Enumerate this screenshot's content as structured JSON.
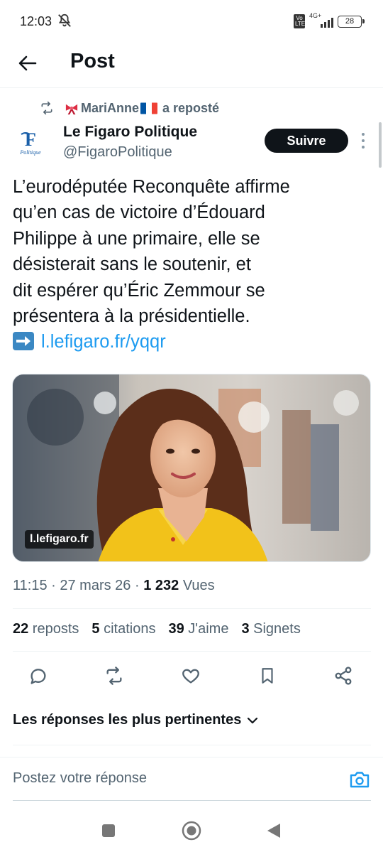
{
  "status_bar": {
    "time": "12:03",
    "network_label": "4G+",
    "volte_label": "Vo LTE",
    "battery": "28"
  },
  "header": {
    "title": "Post"
  },
  "repost": {
    "user": "MariAnne",
    "suffix": " a reposté"
  },
  "author": {
    "name": "Le Figaro Politique",
    "handle": "@FigaroPolitique",
    "avatar_logo_letter": "F",
    "avatar_logo_text": "Politique",
    "follow_label": "Suivre"
  },
  "tweet": {
    "lines": [
      "L’eurodéputée Reconquête affirme",
      "qu’en cas de victoire d’Édouard",
      "Philippe à une primaire, elle se",
      "désisterait sans le soutenir, et",
      "dit espérer qu’Éric Zemmour se",
      "présentera à la présidentielle."
    ],
    "link": "l.lefigaro.fr/yqqr",
    "media_domain": "l.lefigaro.fr"
  },
  "meta": {
    "time": "11:15",
    "sep1": " · ",
    "date": "27 mars 26",
    "sep2": " · ",
    "views_count": "1 232",
    "views_label": " Vues"
  },
  "stats": [
    {
      "count": "22",
      "label": " reposts"
    },
    {
      "count": "5",
      "label": " citations"
    },
    {
      "count": "39",
      "label": " J'aime"
    },
    {
      "count": "3",
      "label": " Signets"
    }
  ],
  "replies": {
    "header": "Les réponses les plus pertinentes"
  },
  "reply_bar": {
    "placeholder": "Postez votre réponse"
  },
  "colors": {
    "accent": "#1d9bf0",
    "text_primary": "#0f1419",
    "text_secondary": "#536471",
    "follow_bg": "#0f1419",
    "blazer": "#f2c21a"
  }
}
